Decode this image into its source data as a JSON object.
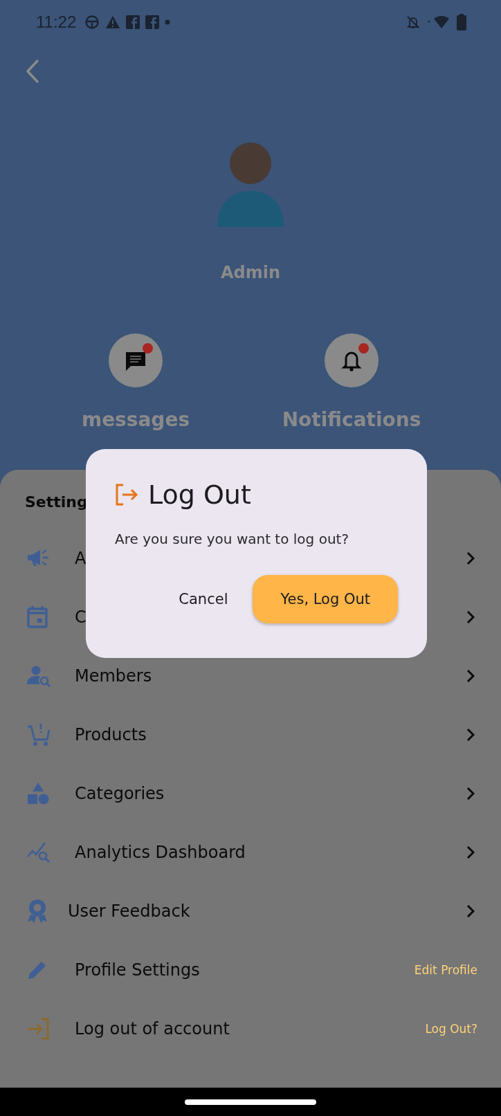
{
  "status_bar": {
    "time": "11:22"
  },
  "profile": {
    "name": "Admin"
  },
  "quick_actions": [
    {
      "kind": "messages",
      "label": "messages",
      "has_badge": true
    },
    {
      "kind": "bell",
      "label": "Notifications",
      "has_badge": true
    }
  ],
  "settings": {
    "title": "Setting",
    "items": [
      {
        "kind": "megaphone",
        "label": "A",
        "chevron": true
      },
      {
        "kind": "calendar",
        "label": "C",
        "chevron": true
      },
      {
        "kind": "person-search",
        "label": "Members",
        "chevron": true
      },
      {
        "kind": "cart",
        "label": "Products",
        "chevron": true
      },
      {
        "kind": "shapes",
        "label": "Categories",
        "chevron": true
      },
      {
        "kind": "analytics",
        "label": "Analytics Dashboard",
        "chevron": true
      },
      {
        "kind": "award",
        "label": "User Feedback",
        "chevron": true
      },
      {
        "kind": "pencil",
        "label": "Profile Settings",
        "chevron": false,
        "link": "Edit Profile"
      },
      {
        "kind": "login",
        "label": "Log out of account",
        "chevron": false,
        "link": "Log Out?"
      }
    ]
  },
  "dialog": {
    "title": "Log Out",
    "message": "Are you sure you want to log out?",
    "buttons": [
      {
        "kind": "text",
        "label": "Cancel"
      },
      {
        "kind": "filled",
        "label": "Yes, Log Out"
      }
    ]
  }
}
